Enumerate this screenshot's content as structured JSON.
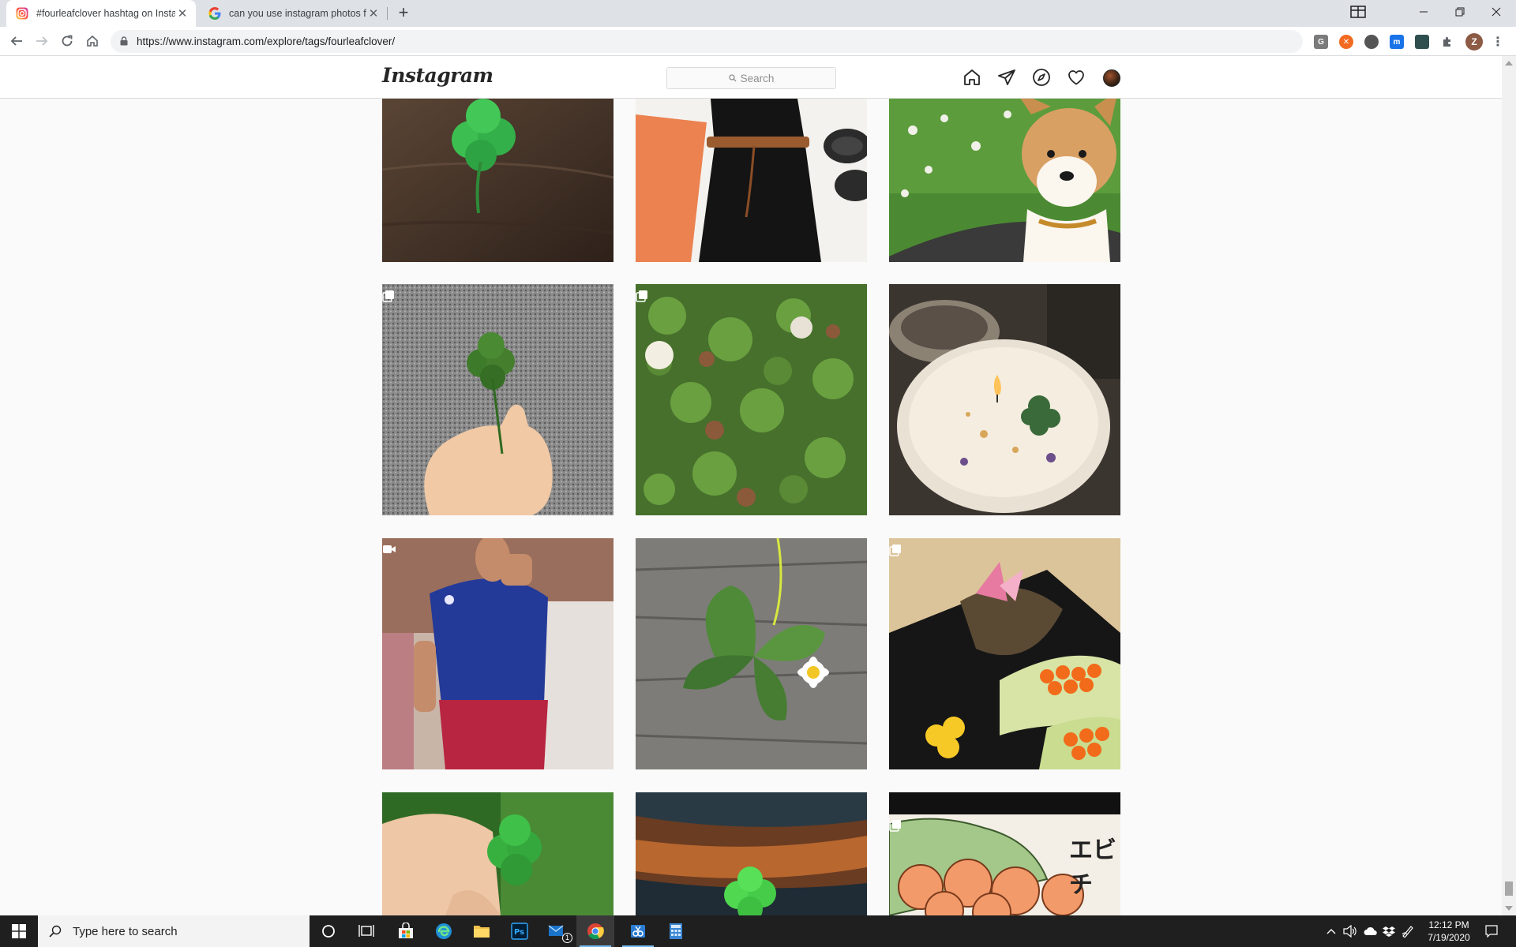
{
  "browser": {
    "tabs": [
      {
        "title": "#fourleafclover hashtag on Instag",
        "active": true,
        "favicon": "instagram-favicon"
      },
      {
        "title": "can you use instagram photos fo",
        "active": false,
        "favicon": "google-favicon"
      }
    ],
    "new_tab": "+",
    "url": "https://www.instagram.com/explore/tags/fourleafclover/",
    "profile_initial": "Z",
    "extensions": [
      "G",
      "✕",
      "",
      "m",
      "",
      ""
    ]
  },
  "instagram": {
    "logo": "Instagram",
    "search_placeholder": "Search",
    "nav_icons": [
      "home-icon",
      "direct-icon",
      "explore-icon",
      "activity-icon",
      "profile-avatar"
    ]
  },
  "grid": {
    "posts": [
      {
        "desc": "clover-on-wood",
        "badge": null
      },
      {
        "desc": "black-dress-flatlay",
        "badge": null
      },
      {
        "desc": "corgi-in-clover",
        "badge": null
      },
      {
        "desc": "clover-in-hand",
        "badge": "carousel"
      },
      {
        "desc": "clover-patch",
        "badge": "carousel"
      },
      {
        "desc": "clover-candle",
        "badge": null
      },
      {
        "desc": "man-blue-shirt",
        "badge": "video"
      },
      {
        "desc": "clover-and-daisy",
        "badge": null
      },
      {
        "desc": "sushi-plate",
        "badge": "carousel"
      },
      {
        "desc": "fingers-holding-clover",
        "badge": null
      },
      {
        "desc": "clover-on-rusty-wood",
        "badge": null
      },
      {
        "desc": "shrimp-illustration",
        "badge": "carousel"
      }
    ],
    "illustration_text": "エビチ"
  },
  "taskbar": {
    "search_placeholder": "Type here to search",
    "time": "12:12 PM",
    "date": "7/19/2020",
    "mail_badge": "1"
  },
  "colors": {
    "ig_bg": "#fafafa",
    "taskbar": "#1f1f1f",
    "chrome_tabstrip": "#dee1e6"
  }
}
